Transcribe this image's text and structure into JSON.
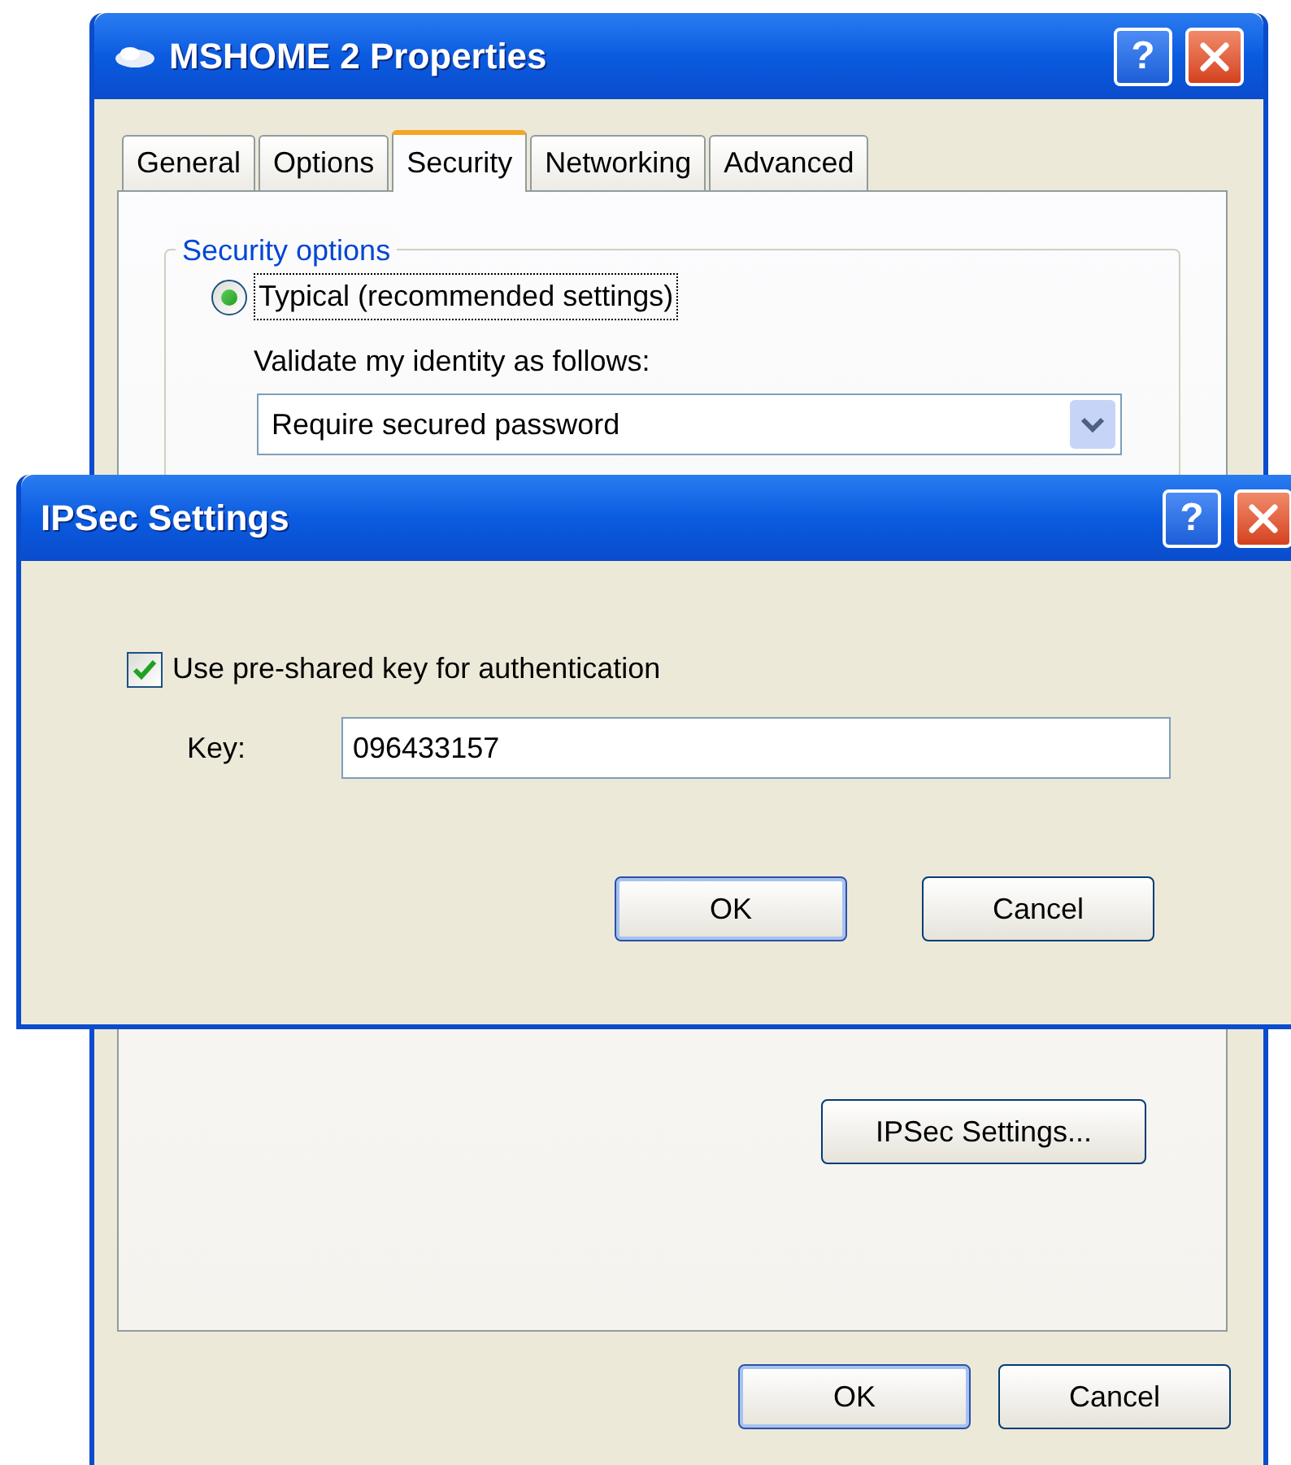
{
  "main_window": {
    "title": "MSHOME 2 Properties",
    "help": "?",
    "tabs": [
      {
        "label": "General",
        "selected": false
      },
      {
        "label": "Options",
        "selected": false
      },
      {
        "label": "Security",
        "selected": true
      },
      {
        "label": "Networking",
        "selected": false
      },
      {
        "label": "Advanced",
        "selected": false
      }
    ],
    "security_options": {
      "legend": "Security options",
      "options": [
        {
          "label": "Typical (recommended settings)",
          "selected": true
        }
      ],
      "validate_label": "Validate my identity as follows:",
      "validate_value": "Require secured password"
    },
    "ipsec_button": "IPSec Settings...",
    "buttons": [
      "OK",
      "Cancel"
    ]
  },
  "ipsec_dialog": {
    "title": "IPSec Settings",
    "help": "?",
    "use_key": {
      "label": "Use pre-shared key for authentication",
      "checked": true
    },
    "key_label": "Key:",
    "key_value": "096433157",
    "buttons": [
      "OK",
      "Cancel"
    ]
  }
}
